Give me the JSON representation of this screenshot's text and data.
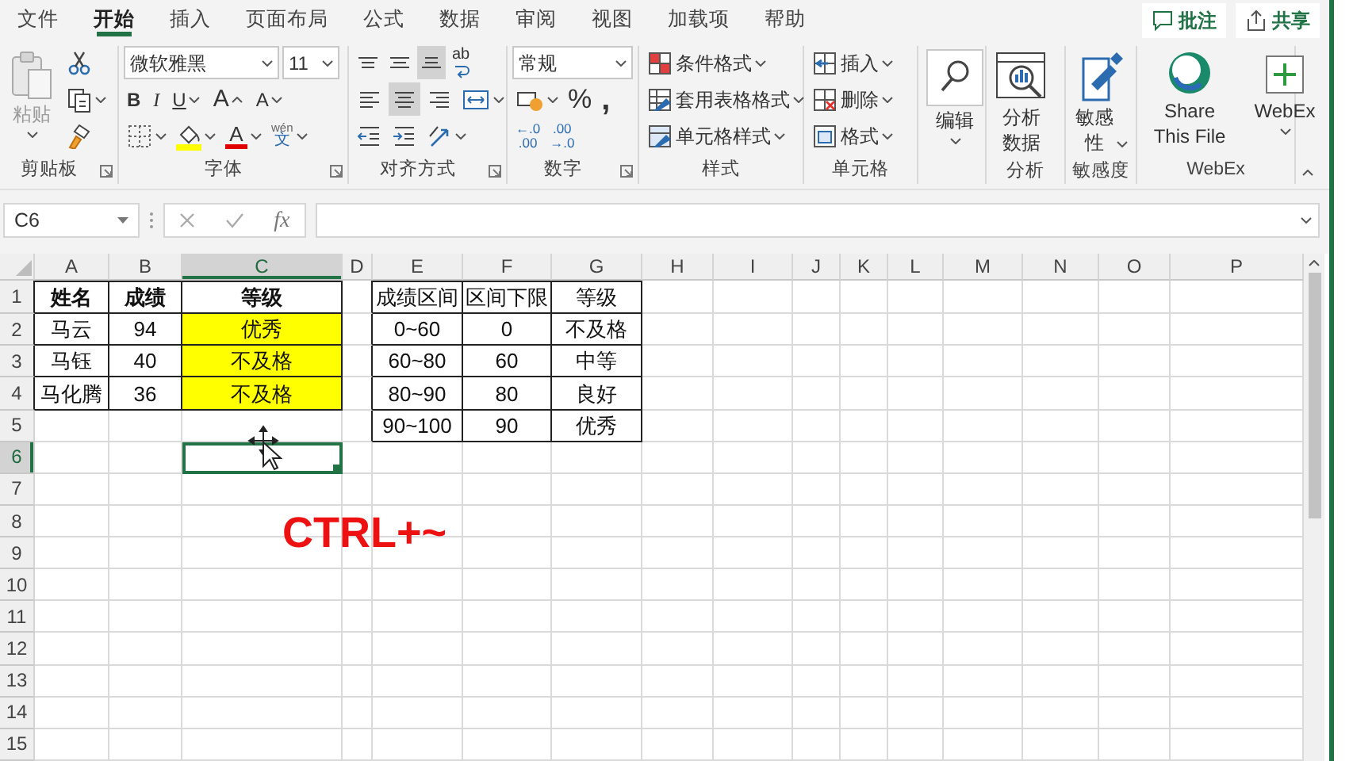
{
  "tabs": [
    {
      "label": "文件",
      "selected": false
    },
    {
      "label": "开始",
      "selected": true
    },
    {
      "label": "插入",
      "selected": false
    },
    {
      "label": "页面布局",
      "selected": false
    },
    {
      "label": "公式",
      "selected": false
    },
    {
      "label": "数据",
      "selected": false
    },
    {
      "label": "审阅",
      "selected": false
    },
    {
      "label": "视图",
      "selected": false
    },
    {
      "label": "加载项",
      "selected": false
    },
    {
      "label": "帮助",
      "selected": false
    }
  ],
  "header_buttons": [
    "批注",
    "共享"
  ],
  "ribbon": {
    "groups": [
      {
        "kind": "clipboard",
        "label": "剪贴板",
        "launcher": true,
        "paste": {
          "label": "粘贴",
          "disabled": true
        }
      },
      {
        "kind": "font",
        "label": "字体",
        "launcher": true,
        "font_name": "微软雅黑",
        "font_size": "11",
        "bold": "B",
        "italic": "I",
        "underline": "U",
        "grow": "A",
        "shrink": "A",
        "font_color": "A",
        "phonetic": "wén",
        "phonetic_char": "文"
      },
      {
        "kind": "alignment",
        "label": "对齐方式",
        "launcher": true,
        "vertical": [
          {
            "selected": false
          },
          {
            "selected": false
          },
          {
            "selected": true
          }
        ],
        "horizontal": [
          {
            "selected": false
          },
          {
            "selected": true
          },
          {
            "selected": false
          }
        ],
        "wrap": "ab"
      },
      {
        "kind": "number",
        "label": "数字",
        "launcher": true,
        "format": "常规",
        "percent": "%",
        "comma": ",",
        "increase_decimal": [
          "←.0",
          ".00"
        ],
        "decrease_decimal": [
          ".00",
          "→.0"
        ]
      },
      {
        "kind": "styles",
        "label": "样式",
        "items": [
          "条件格式",
          "套用表格格式",
          "单元格样式"
        ]
      },
      {
        "kind": "cells",
        "label": "单元格",
        "items": [
          "插入",
          "删除",
          "格式"
        ]
      },
      {
        "kind": "editing",
        "button": "编辑"
      },
      {
        "kind": "analysis",
        "label": "分析",
        "button": "分析数据"
      },
      {
        "kind": "sensitivity",
        "label": "敏感度",
        "button": "敏感性"
      },
      {
        "kind": "webex",
        "label": "WebEx",
        "buttons": [
          "Share This File",
          "WebEx"
        ]
      }
    ]
  },
  "formula_bar": {
    "name_box": "C6",
    "function_label": "fx"
  },
  "sheet": {
    "columns": [
      {
        "label": "A",
        "selected": false
      },
      {
        "label": "B",
        "selected": false
      },
      {
        "label": "C",
        "selected": true
      },
      {
        "label": "D",
        "selected": false
      },
      {
        "label": "E",
        "selected": false
      },
      {
        "label": "F",
        "selected": false
      },
      {
        "label": "G",
        "selected": false
      },
      {
        "label": "H",
        "selected": false
      },
      {
        "label": "I",
        "selected": false
      },
      {
        "label": "J",
        "selected": false
      },
      {
        "label": "K",
        "selected": false
      },
      {
        "label": "L",
        "selected": false
      },
      {
        "label": "M",
        "selected": false
      },
      {
        "label": "N",
        "selected": false
      },
      {
        "label": "O",
        "selected": false
      },
      {
        "label": "P",
        "selected": false
      }
    ],
    "rows": [
      {
        "label": "1",
        "selected": false,
        "cells": [
          {
            "text": "姓名",
            "bold": true,
            "bordered": true
          },
          {
            "text": "成绩",
            "bold": true,
            "bordered": true
          },
          {
            "text": "等级",
            "bold": true,
            "bordered": true
          },
          {},
          {
            "text": "成绩区间",
            "bordered": true
          },
          {
            "text": "区间下限",
            "bordered": true
          },
          {
            "text": "等级",
            "bordered": true
          }
        ]
      },
      {
        "label": "2",
        "selected": false,
        "cells": [
          {
            "text": "马云",
            "bordered": true
          },
          {
            "text": "94",
            "bordered": true
          },
          {
            "text": "优秀",
            "bordered": true,
            "highlighted": true
          },
          {},
          {
            "text": "0~60",
            "bordered": true
          },
          {
            "text": "0",
            "bordered": true
          },
          {
            "text": "不及格",
            "bordered": true
          }
        ]
      },
      {
        "label": "3",
        "selected": false,
        "cells": [
          {
            "text": "马钰",
            "bordered": true
          },
          {
            "text": "40",
            "bordered": true
          },
          {
            "text": "不及格",
            "bordered": true,
            "highlighted": true
          },
          {},
          {
            "text": "60~80",
            "bordered": true
          },
          {
            "text": "60",
            "bordered": true
          },
          {
            "text": "中等",
            "bordered": true
          }
        ]
      },
      {
        "label": "4",
        "selected": false,
        "cells": [
          {
            "text": "马化腾",
            "bordered": true
          },
          {
            "text": "36",
            "bordered": true
          },
          {
            "text": "不及格",
            "bordered": true,
            "highlighted": true
          },
          {},
          {
            "text": "80~90",
            "bordered": true
          },
          {
            "text": "80",
            "bordered": true
          },
          {
            "text": "良好",
            "bordered": true
          }
        ]
      },
      {
        "label": "5",
        "selected": false,
        "cells": [
          {},
          {},
          {},
          {},
          {
            "text": "90~100",
            "bordered": true
          },
          {
            "text": "90",
            "bordered": true
          },
          {
            "text": "优秀",
            "bordered": true
          }
        ]
      },
      {
        "label": "6",
        "selected": true
      },
      {
        "label": "7",
        "selected": false
      },
      {
        "label": "8",
        "selected": false
      },
      {
        "label": "9",
        "selected": false
      },
      {
        "label": "10",
        "selected": false
      },
      {
        "label": "11",
        "selected": false
      },
      {
        "label": "12",
        "selected": false
      },
      {
        "label": "13",
        "selected": false
      },
      {
        "label": "14",
        "selected": false
      },
      {
        "label": "15",
        "selected": false
      }
    ]
  },
  "overlay_text": "CTRL+~"
}
